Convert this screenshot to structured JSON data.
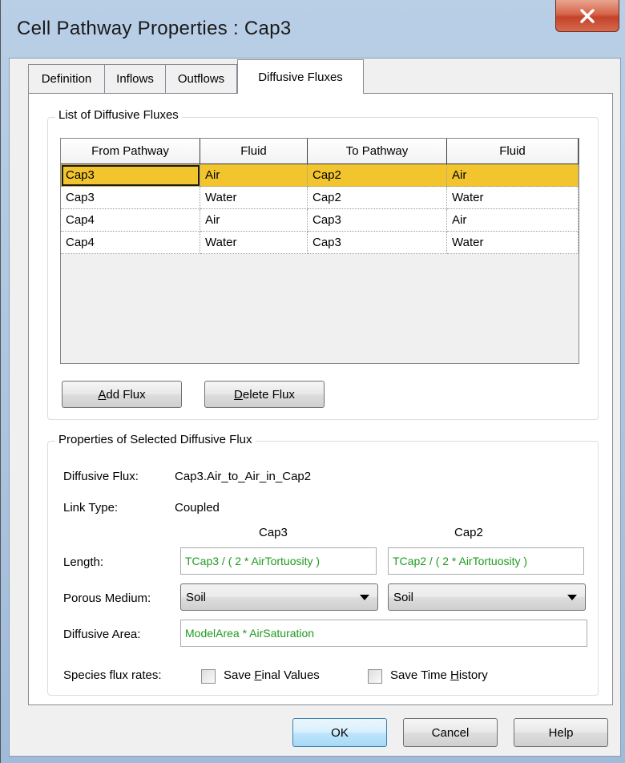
{
  "window": {
    "title": "Cell Pathway Properties : Cap3",
    "close_icon": "close-x-icon"
  },
  "tabs": [
    {
      "label": "Definition",
      "active": false
    },
    {
      "label": "Inflows",
      "active": false
    },
    {
      "label": "Outflows",
      "active": false
    },
    {
      "label": "Diffusive Fluxes",
      "active": true
    }
  ],
  "flux_list": {
    "legend": "List of Diffusive Fluxes",
    "columns": [
      "From Pathway",
      "Fluid",
      "To Pathway",
      "Fluid"
    ],
    "rows": [
      [
        "Cap3",
        "Air",
        "Cap2",
        "Air"
      ],
      [
        "Cap3",
        "Water",
        "Cap2",
        "Water"
      ],
      [
        "Cap4",
        "Air",
        "Cap3",
        "Air"
      ],
      [
        "Cap4",
        "Water",
        "Cap3",
        "Water"
      ]
    ],
    "selected_row": 0,
    "selected_color": "#f2c52e",
    "add_button": {
      "mnemonic": "A",
      "rest": "dd Flux"
    },
    "delete_button": {
      "mnemonic": "D",
      "rest": "elete Flux"
    }
  },
  "properties": {
    "legend": "Properties of Selected Diffusive Flux",
    "diffusive_flux_label": "Diffusive Flux:",
    "diffusive_flux_value": "Cap3.Air_to_Air_in_Cap2",
    "link_type_label": "Link Type:",
    "link_type_value": "Coupled",
    "from_header": "Cap3",
    "to_header": "Cap2",
    "length_label": "Length:",
    "length_from": "TCap3 / ( 2 * AirTortuosity )",
    "length_to": "TCap2 / ( 2 * AirTortuosity )",
    "porous_label": "Porous Medium:",
    "porous_from": "Soil",
    "porous_to": "Soil",
    "area_label": "Diffusive Area:",
    "area_value": "ModelArea * AirSaturation",
    "species_label": "Species flux rates:",
    "save_final": {
      "pre": "Save ",
      "mnemonic": "F",
      "post": "inal Values",
      "checked": false
    },
    "save_history": {
      "pre": "Save Time ",
      "mnemonic": "H",
      "post": "istory",
      "checked": false
    },
    "expression_color": "#1f9b1f"
  },
  "buttons": {
    "ok": "OK",
    "cancel": "Cancel",
    "help": "Help"
  }
}
